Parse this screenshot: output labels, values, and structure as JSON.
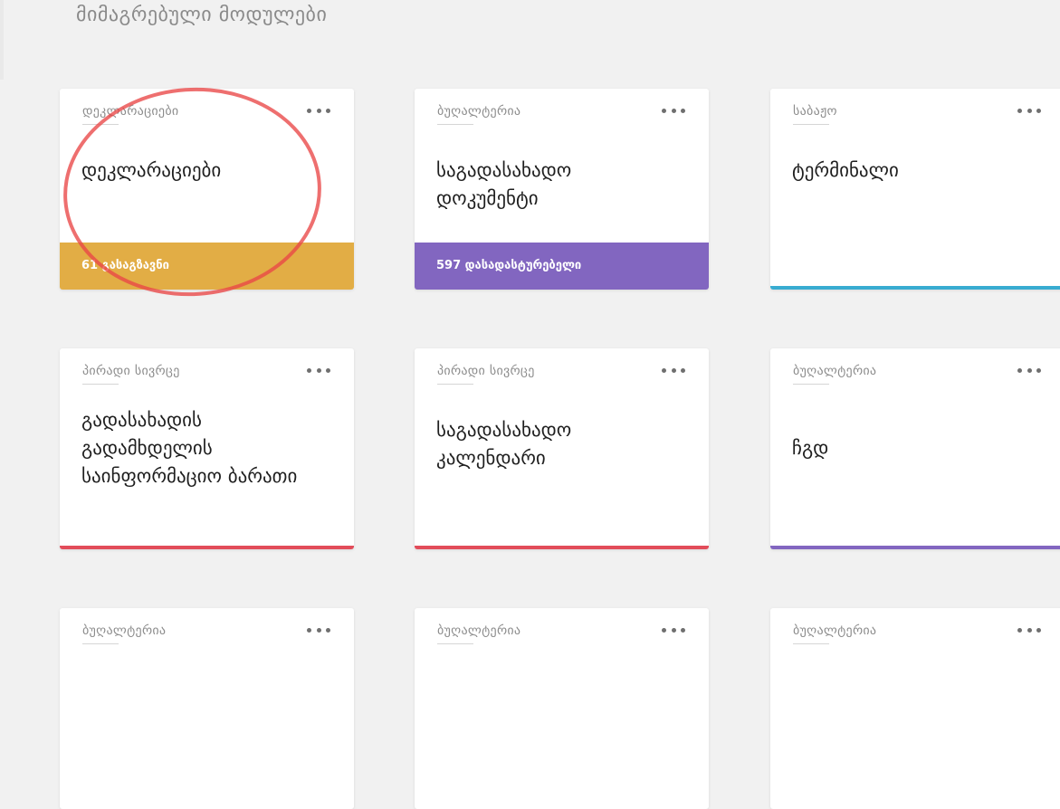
{
  "page": {
    "title": "მიმაგრებული მოდულები"
  },
  "colors": {
    "background": "#f1f1f1",
    "orange": "#e2ad45",
    "purple": "#8266c0",
    "cyan": "#38acd1",
    "red": "#e24c5a",
    "annotation": "#e94646"
  },
  "cards": [
    {
      "category": "დეკლარაციები",
      "title": "დეკლარაციები",
      "footer_text": "61 გასაგზავნი",
      "accent": "#e2ad45"
    },
    {
      "category": "ბუღალტერია",
      "title": "საგადასახადო\nდოკუმენტი",
      "footer_text": "597 დასადასტურებელი",
      "accent": "#8266c0"
    },
    {
      "category": "საბაჟო",
      "title": "ტერმინალი",
      "footer_text": "",
      "accent": "#38acd1"
    },
    {
      "category": "პირადი სივრცე",
      "title": "გადასახადის\nგადამხდელის\nსაინფორმაციო ბარათი",
      "footer_text": "",
      "accent": "#e24c5a"
    },
    {
      "category": "პირადი სივრცე",
      "title": "საგადასახადო\nკალენდარი",
      "footer_text": "",
      "accent": "#e24c5a"
    },
    {
      "category": "ბუღალტერია",
      "title": "ჩგდ",
      "footer_text": "",
      "accent": "#8266c0"
    },
    {
      "category": "ბუღალტერია",
      "title": "",
      "footer_text": "",
      "accent": ""
    },
    {
      "category": "ბუღალტერია",
      "title": "",
      "footer_text": "",
      "accent": ""
    },
    {
      "category": "ბუღალტერია",
      "title": "",
      "footer_text": "",
      "accent": ""
    }
  ],
  "icons": {
    "more": "more-dots-icon"
  }
}
